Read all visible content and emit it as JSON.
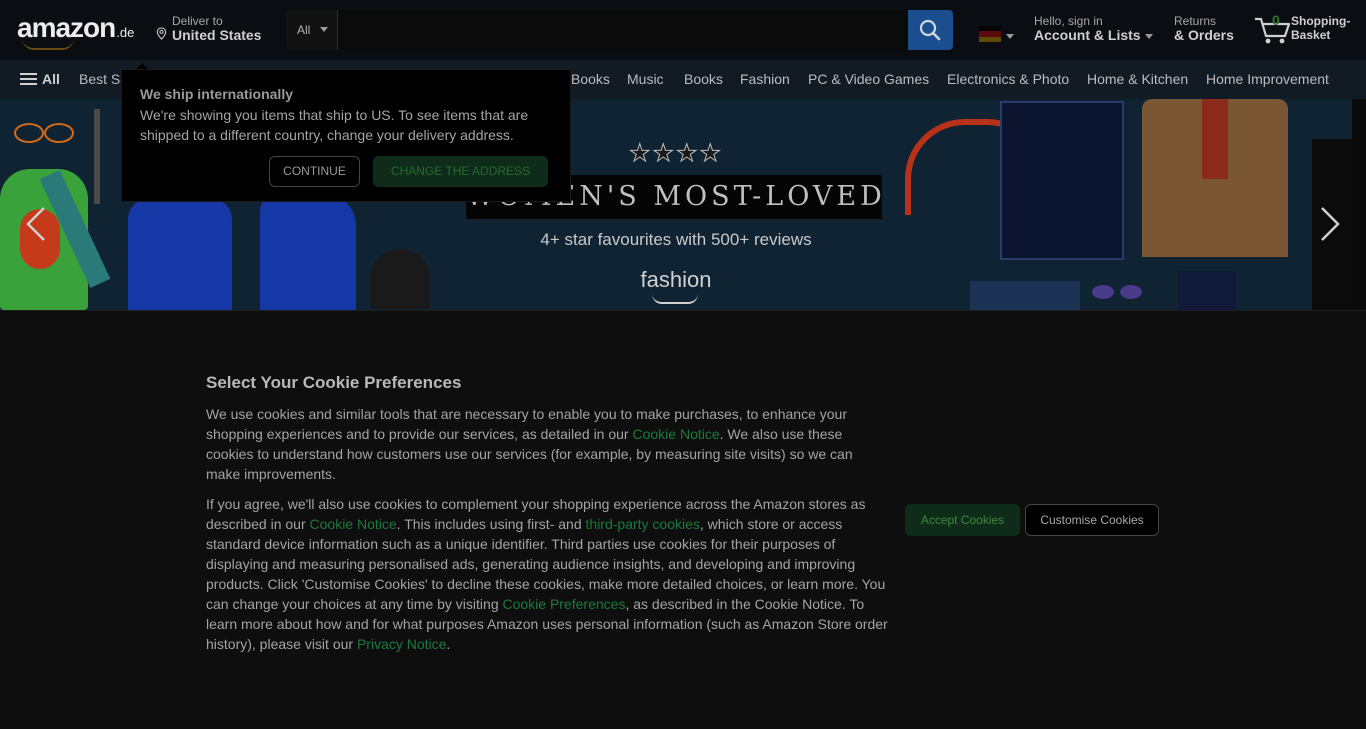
{
  "header": {
    "logo_text": "amazon",
    "logo_tld": ".de",
    "deliver_line1": "Deliver to",
    "deliver_line2": "United States",
    "search_category": "All",
    "search_placeholder": "",
    "account_line1": "Hello, sign in",
    "account_line2": "Account & Lists",
    "orders_line1": "Returns",
    "orders_line2": "& Orders",
    "cart_count": "0",
    "cart_line1": "Shopping-",
    "cart_line2": "Basket"
  },
  "nav": {
    "all_label": "All",
    "items": [
      "Best Sellers",
      "Books",
      "Music",
      "Books",
      "Fashion",
      "PC & Video Games",
      "Electronics & Photo",
      "Home & Kitchen",
      "Home Improvement"
    ]
  },
  "popover": {
    "title": "We ship internationally",
    "text": "We're showing you items that ship to US. To see items that are shipped to a different country, change your delivery address.",
    "continue_label": "CONTINUE",
    "change_label": "CHANGE THE ADDRESS"
  },
  "banner": {
    "stars": "★★★★",
    "title": "WOMEN'S MOST-LOVED",
    "subtitle": "4+ star favourites with 500+ reviews",
    "brand": "fashion"
  },
  "cookie": {
    "title": "Select Your Cookie Preferences",
    "p1_a": "We use cookies and similar tools that are necessary to enable you to make purchases, to enhance your shopping experiences and to provide our services, as detailed in our ",
    "p1_link": "Cookie Notice",
    "p1_b": ". We also use these cookies to understand how customers use our services (for example, by measuring site visits) so we can make improvements.",
    "p2_a": "If you agree, we'll also use cookies to complement your shopping experience across the Amazon stores as described in our ",
    "p2_link1": "Cookie Notice",
    "p2_b": ". This includes using first- and ",
    "p2_link2": "third-party cookies",
    "p2_c": ", which store or access standard device information such as a unique identifier. Third parties use cookies for their purposes of displaying and measuring personalised ads, generating audience insights, and developing and improving products. Click 'Customise Cookies' to decline these cookies, make more detailed choices, or learn more. You can change your choices at any time by visiting ",
    "p2_link3": "Cookie Preferences",
    "p2_d": ", as described in the Cookie Notice. To learn more about how and for what purposes Amazon uses personal information (such as Amazon Store order history), please visit our ",
    "p2_link4": "Privacy Notice",
    "p2_e": ".",
    "accept_label": "Accept Cookies",
    "customise_label": "Customise Cookies"
  },
  "colors": {
    "search_button": "#1a4e8f",
    "accept_button": "#0f2c1a",
    "link": "#1c7a3d"
  },
  "icons": [
    "location-pin-icon",
    "search-icon",
    "flag-icon",
    "cart-icon",
    "menu-icon",
    "chevron-left-icon",
    "chevron-right-icon"
  ]
}
